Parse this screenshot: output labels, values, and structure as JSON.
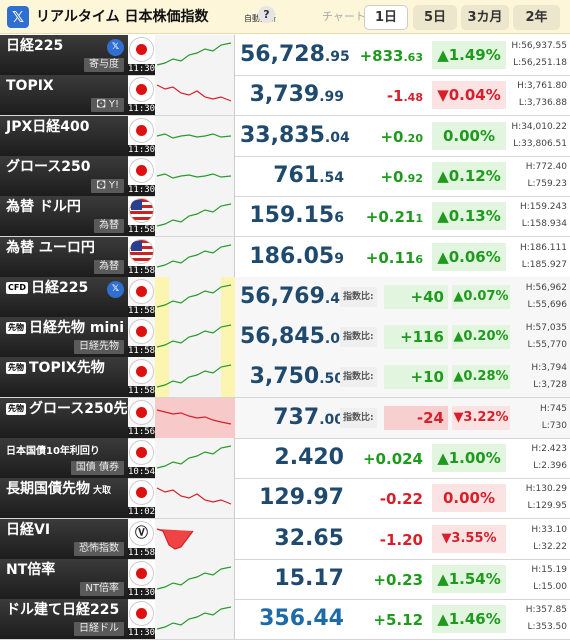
{
  "header": {
    "title": "リアルタイム 日本株価指数",
    "auto_label": "自動更新",
    "help_icon": "?",
    "chart_label": "チャート:",
    "tabs": [
      {
        "label": "1日",
        "active": true
      },
      {
        "label": "5日"
      },
      {
        "label": "3カ月"
      },
      {
        "label": "2年"
      }
    ]
  },
  "rows": [
    {
      "name": "日経225",
      "sub": "寄与度",
      "time": "11:30",
      "flag": "jp",
      "x": true,
      "price": "56,728",
      "dec": ".95",
      "chg": "+833",
      "chgd": ".63",
      "pct": "▲1.49%",
      "dir": "up",
      "high": "H:56,937.55",
      "low": "L:56,251.18",
      "spark": "up"
    },
    {
      "name": "TOPIX",
      "sub": "🖸 Y!",
      "time": "11:30",
      "flag": "jp",
      "price": "3,739",
      "dec": ".99",
      "chg": "-1",
      "chgd": ".48",
      "pct": "▼0.04%",
      "dir": "dn",
      "high": "H:3,761.80",
      "low": "L:3,736.88",
      "spark": "dn"
    },
    {
      "name": "JPX日経400",
      "sub": "",
      "time": "11:30",
      "flag": "jp",
      "price": "33,835",
      "dec": ".04",
      "chg": "+0",
      "chgd": ".20",
      "pct": "0.00%",
      "dir": "fl0",
      "high": "H:34,010.22",
      "low": "L:33,806.51",
      "spark": "flat"
    },
    {
      "name": "グロース250",
      "sub": "🖸 Y!",
      "time": "11:30",
      "flag": "jp",
      "price": "761",
      "dec": ".54",
      "chg": "+0",
      "chgd": ".92",
      "pct": "▲0.12%",
      "dir": "up",
      "high": "H:772.40",
      "low": "L:759.23",
      "spark": "flat"
    },
    {
      "name": "為替 ドル円",
      "sub": "為替",
      "time": "11:58",
      "flag": "us",
      "price": "159.15",
      "dec": "6",
      "chg": "+0.21",
      "chgd": "1",
      "pct": "▲0.13%",
      "dir": "up",
      "high": "H:159.243",
      "low": "L:158.934",
      "spark": "up"
    },
    {
      "name": "為替 ユーロ円",
      "sub": "為替",
      "time": "11:58",
      "flag": "us",
      "price": "186.05",
      "dec": "9",
      "chg": "+0.11",
      "chgd": "6",
      "pct": "▲0.06%",
      "dir": "up",
      "high": "H:186.111",
      "low": "L:185.927",
      "spark": "up"
    },
    {
      "name": "日経225",
      "cfd": "CFD",
      "sub": "",
      "time": "11:58",
      "flag": "jp",
      "x": true,
      "price": "56,769",
      "dec": ".40",
      "idx": "指数比:",
      "chg2": "+40",
      "pct2": "▲0.07%",
      "dir": "up",
      "high": "H:56,962",
      "low": "L:55,696",
      "spark": "up",
      "cfdrow": true
    },
    {
      "name": "日経先物 mini",
      "cfd": "先物",
      "sub": "日経先物",
      "time": "11:58",
      "flag": "jp",
      "price": "56,845",
      "dec": ".00",
      "idx": "指数比:",
      "chg2": "+116",
      "pct2": "▲0.20%",
      "dir": "up",
      "high": "H:57,035",
      "low": "L:55,770",
      "spark": "up",
      "cfdrow": true
    },
    {
      "name": "TOPIX先物",
      "cfd": "先物",
      "sub": "",
      "time": "11:58",
      "flag": "jp",
      "price": "3,750",
      "dec": ".50",
      "idx": "指数比:",
      "chg2": "+10",
      "pct2": "▲0.28%",
      "dir": "up",
      "high": "H:3,794",
      "low": "L:3,728",
      "spark": "up",
      "cfdrow": true
    },
    {
      "name": "グロース250先物",
      "cfd": "先物",
      "sub": "",
      "time": "11:56",
      "flag": "jp",
      "price": "737",
      "dec": ".00",
      "idx": "指数比:",
      "chg2": "-24",
      "pct2": "▼3.22%",
      "dir": "dn",
      "high": "H:745",
      "low": "L:730",
      "spark": "red",
      "cfdrow": true
    },
    {
      "name": "日本国債10年利回り",
      "sub": "国債 債券",
      "time": "10:54",
      "flag": "jp",
      "price": "2.420",
      "dec": "",
      "chg": "+0.024",
      "chgd": "",
      "pct": "▲1.00%",
      "dir": "up",
      "high": "H:2.423",
      "low": "L:2.396",
      "spark": "up",
      "xs": true
    },
    {
      "name": "長期国債先物",
      "suffix": "大取",
      "sub": "",
      "time": "11:02",
      "flag": "jp",
      "price": "129.97",
      "dec": "",
      "chg": "-0.22",
      "chgd": "",
      "pct": "0.00%",
      "dir": "dn",
      "high": "H:130.29",
      "low": "L:129.95",
      "spark": "dn"
    },
    {
      "name": "日経VI",
      "sub": "恐怖指数",
      "time": "11:58",
      "flag": "vi",
      "price": "32.65",
      "dec": "",
      "chg": "-1.20",
      "chgd": "",
      "pct": "▼3.55%",
      "dir": "dn",
      "high": "H:33.10",
      "low": "L:32.22",
      "spark": "redfill",
      "pctsmall": true
    },
    {
      "name": "NT倍率",
      "sub": "NT倍率",
      "time": "11:30",
      "flag": "jp",
      "price": "15.17",
      "dec": "",
      "chg": "+0.23",
      "chgd": "",
      "pct": "▲1.54%",
      "dir": "up",
      "high": "H:15.19",
      "low": "L:15.00",
      "spark": "up"
    },
    {
      "name": "ドル建て日経225",
      "sub": "日経ドル",
      "time": "11:30",
      "flag": "jp",
      "price": "356.44",
      "dec": "",
      "chg": "+5.12",
      "chgd": "",
      "pct": "▲1.46%",
      "dir": "up",
      "high": "H:357.85",
      "low": "L:353.50",
      "spark": "up",
      "blue": true
    }
  ],
  "colors": {
    "up": "#1f9a1f",
    "down": "#d81f2a",
    "price": "#1f4a6e",
    "label_bg": "#2b2b2b",
    "header_bg": "#fdf6d9"
  }
}
